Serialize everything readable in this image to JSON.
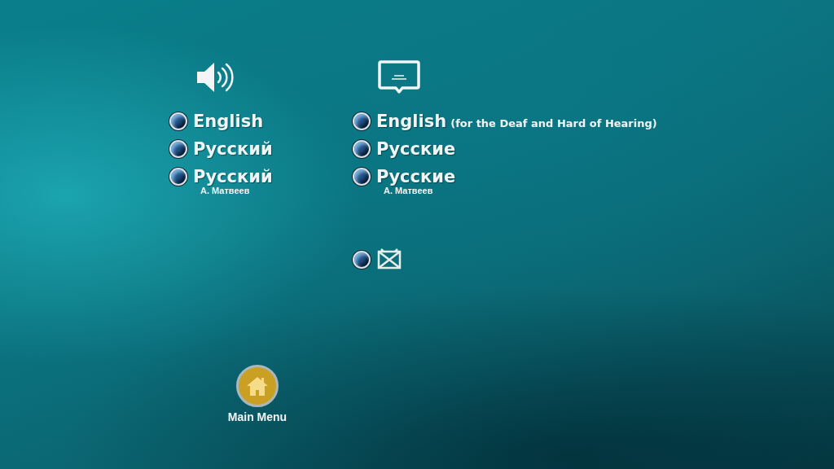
{
  "audio": {
    "options": [
      {
        "label": "English"
      },
      {
        "label": "Русский"
      },
      {
        "label": "Русский",
        "credit": "А. Матвеев"
      }
    ]
  },
  "subtitles": {
    "options": [
      {
        "kind": "language",
        "label": "English",
        "note": "(for the Deaf and Hard of Hearing)"
      },
      {
        "kind": "language",
        "label": "Русские"
      },
      {
        "kind": "language",
        "label": "Русские",
        "credit": "А. Матвеев"
      },
      {
        "kind": "off"
      }
    ]
  },
  "main_menu": {
    "label": "Main Menu"
  }
}
